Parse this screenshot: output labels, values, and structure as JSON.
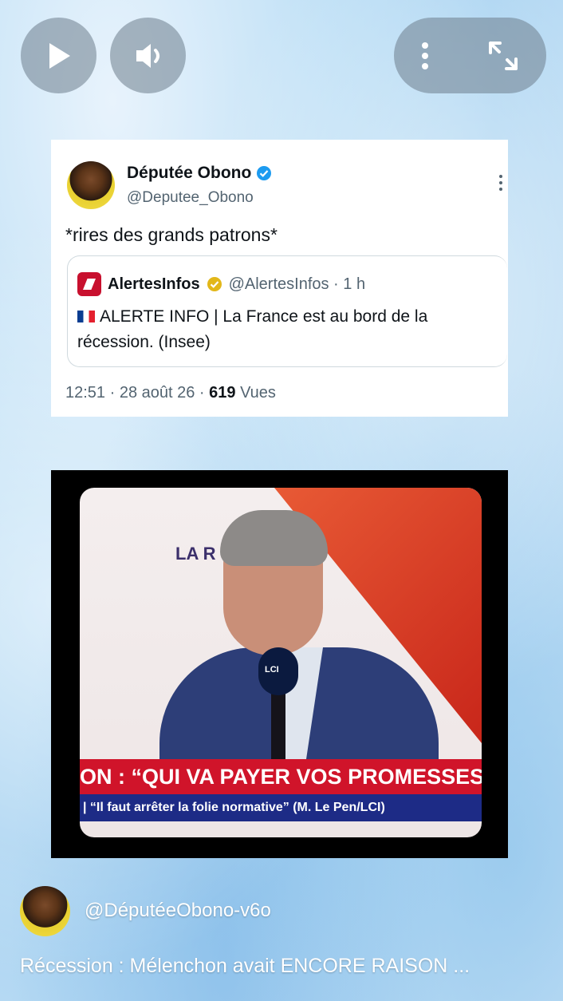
{
  "player": {
    "play_icon": "play-icon",
    "volume_icon": "volume-icon",
    "more_icon": "more-vertical-icon",
    "fullscreen_icon": "fullscreen-icon"
  },
  "tweet": {
    "author_name": "Députée Obono",
    "author_handle": "@Deputee_Obono",
    "text": "*rires des grands patrons*",
    "quoted": {
      "name": "AlertesInfos",
      "handle_time": "@AlertesInfos · 1 h",
      "body": "ALERTE INFO | La France est au bord de la récession. (Insee)"
    },
    "time_date": "12:51 · 28 août 26 · ",
    "views_count": "619",
    "views_label": " Vues"
  },
  "video_frame": {
    "logo_text": "LA R",
    "mic_label": "LCI",
    "headline": "ON : “QUI VA PAYER VOS PROMESSES ?",
    "ticker": "| “Il faut arrêter la folie normative” (M. Le Pen/LCI)"
  },
  "channel": {
    "name": "@DéputéeObono-v6o"
  },
  "video_title": "Récession : Mélenchon avait ENCORE RAISON ...",
  "colors": {
    "verified_blue": "#1d9bf0",
    "verified_gold": "#e2b719",
    "banner_red": "#d0142a",
    "banner_blue": "#1d2b86"
  }
}
